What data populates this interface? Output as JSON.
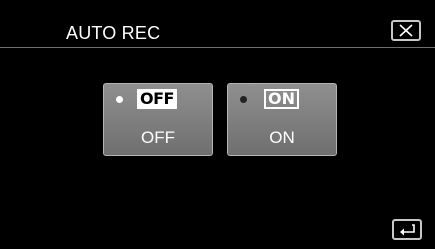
{
  "header": {
    "title": "AUTO REC",
    "close_icon": "close-x-icon"
  },
  "options": [
    {
      "badge": "OFF",
      "label": "OFF",
      "selected": true
    },
    {
      "badge": "ON",
      "label": "ON",
      "selected": false
    }
  ],
  "footer": {
    "return_icon": "return-arrow-icon"
  },
  "colors": {
    "background": "#000000",
    "button_face": "#808080",
    "text": "#ffffff"
  }
}
